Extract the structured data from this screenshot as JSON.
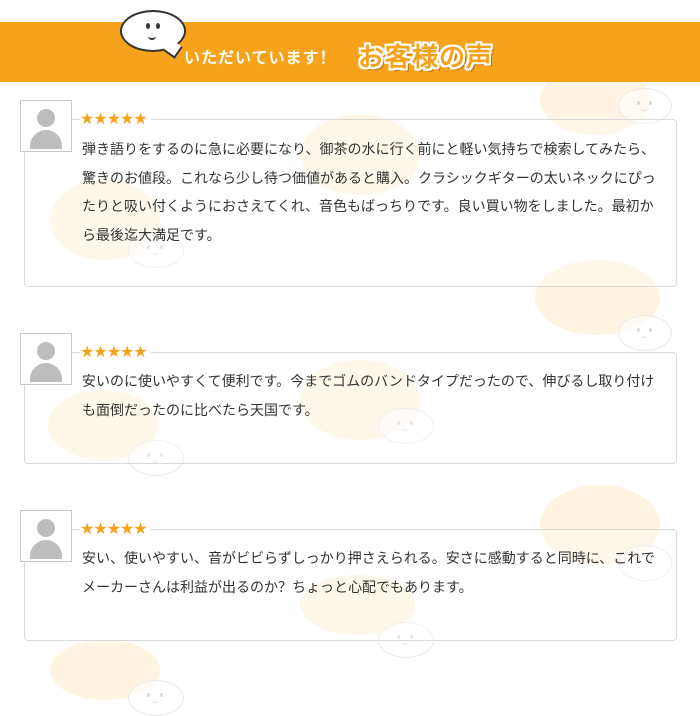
{
  "header": {
    "subtitle": "いただいています！",
    "title": "お客様の声"
  },
  "colors": {
    "accent": "#f7a21b",
    "star": "#f7a21b",
    "text": "#333333",
    "border": "#d9d9d9"
  },
  "reviews": [
    {
      "rating_stars": "★★★★★",
      "rating": 5,
      "text": "弾き語りをするのに急に必要になり、御茶の水に行く前にと軽い気持ちで検索してみたら、驚きのお値段。これなら少し待つ価値があると購入。クラシックギターの太いネックにぴったりと吸い付くようにおさえてくれ、音色もばっちりです。良い買い物をしました。最初から最後迄大満足です。"
    },
    {
      "rating_stars": "★★★★★",
      "rating": 5,
      "text": "安いのに使いやすくて便利です。今までゴムのバンドタイプだったので、伸びるし取り付けも面倒だったのに比べたら天国です。"
    },
    {
      "rating_stars": "★★★★★",
      "rating": 5,
      "text": "安い、使いやすい、音がビビらずしっかり押さえられる。安さに感動すると同時に、これでメーカーさんは利益が出るのか？ちょっと心配でもあります。"
    }
  ]
}
